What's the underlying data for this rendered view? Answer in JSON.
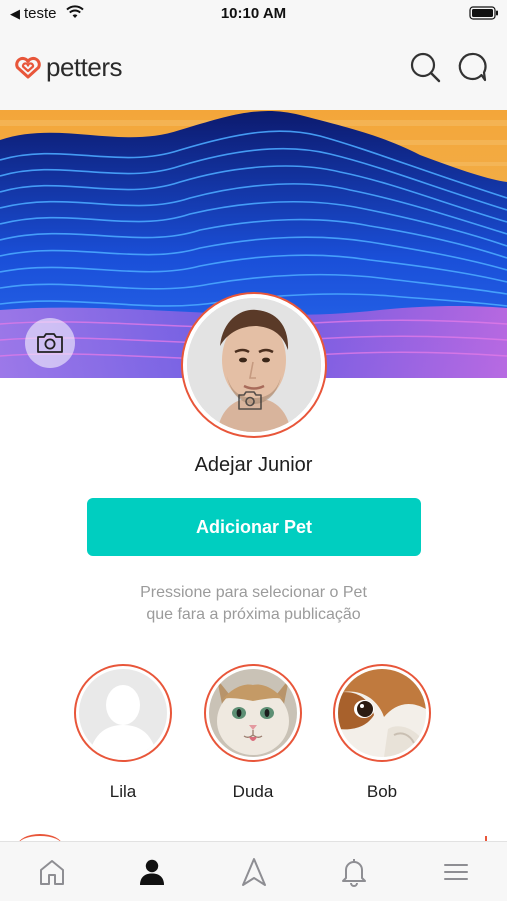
{
  "status_bar": {
    "back_glyph": "◀",
    "carrier": "teste",
    "time": "10:10 AM",
    "wifi_icon": "wifi-icon",
    "battery_icon": "battery-icon"
  },
  "header": {
    "logo_text": "petters",
    "search_icon": "search-icon",
    "chat_icon": "chat-icon"
  },
  "profile": {
    "name": "Adejar Junior",
    "add_pet_label": "Adicionar Pet",
    "hint_line1": "Pressione para selecionar o Pet",
    "hint_line2": "que fara a próxima publicação"
  },
  "pets": [
    {
      "name": "Lila",
      "photo": "placeholder-silhouette"
    },
    {
      "name": "Duda",
      "photo": "kitten"
    },
    {
      "name": "Bob",
      "photo": "puppy"
    }
  ],
  "tab_bar": {
    "items": [
      "home-icon",
      "profile-icon",
      "navigate-icon",
      "bell-icon",
      "menu-icon"
    ],
    "active": "profile-icon"
  },
  "colors": {
    "accent": "#e8563a",
    "primary_button": "#00cec0",
    "icon_gray": "#8e8e93",
    "active_icon": "#111111"
  }
}
